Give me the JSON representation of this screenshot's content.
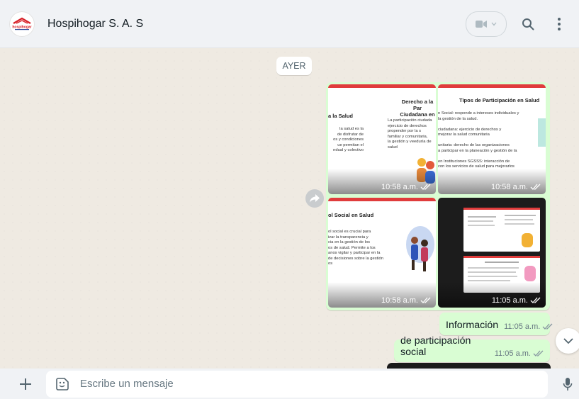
{
  "header": {
    "contact_name": "Hospihogar S. A. S",
    "logo_text": "hospihogar",
    "icons": {
      "video": "video-icon",
      "dropdown": "chevron-down-icon",
      "search": "search-icon",
      "menu": "menu-icon"
    }
  },
  "chat": {
    "date_divider": "AYER",
    "album": {
      "images": [
        {
          "slide_title": "Derecho a la Par\nCiudadana en",
          "slide_left_title": "a la Salud",
          "slide_text": "La participación ciudada\nejercicio de derechos\npropender por la s\nfamiliar y comunitaria,\nla gestión y veeduría de\nsalud",
          "slide_left_text": "la salud es la\nde disfrutar de\nos y condiciones\nue permitan el\nndual y colectivo",
          "time": "10:58 a.m."
        },
        {
          "slide_title": "Tipos de Participación en Salud",
          "slide_text": "n Social: responde a intereses individuales y\nla gestión de la salud.\n\nciudadana: ejercicio de derechos y\nmejorar la salud comunitaria\n\nunitaria: derecho de las organizaciones\na participar en la planeación y gestión de la\n\nen Instituciones SGSSS: interacción de\ncon los servicios de salud para mejorarlos",
          "time": "10:58 a.m."
        },
        {
          "slide_title": "ol Social en Salud",
          "slide_text": "ol social es crucial para\nizar la transparencia y\ncia en la gestión de los\nos de salud. Permite a los\nanos vigilar y participar en la\nde decisiones sobre la gestión\nos",
          "time": "10:58 a.m."
        },
        {
          "slide_title": "",
          "slide_text": "",
          "time": "11:05 a.m."
        }
      ]
    },
    "messages": [
      {
        "text": "Información",
        "time": "11:05 a.m."
      },
      {
        "text": "de participación social",
        "time": "11:05 a.m."
      }
    ]
  },
  "composer": {
    "placeholder": "Escribe un mensaje",
    "icons": {
      "attach": "plus-icon",
      "emoji": "emoji-icon",
      "voice": "microphone-icon"
    }
  },
  "colors": {
    "outgoing_bubble": "#d9fdd3",
    "chat_bg": "#efeae2",
    "header_bg": "#f0f2f5",
    "read_ticks": "#8696a0"
  }
}
